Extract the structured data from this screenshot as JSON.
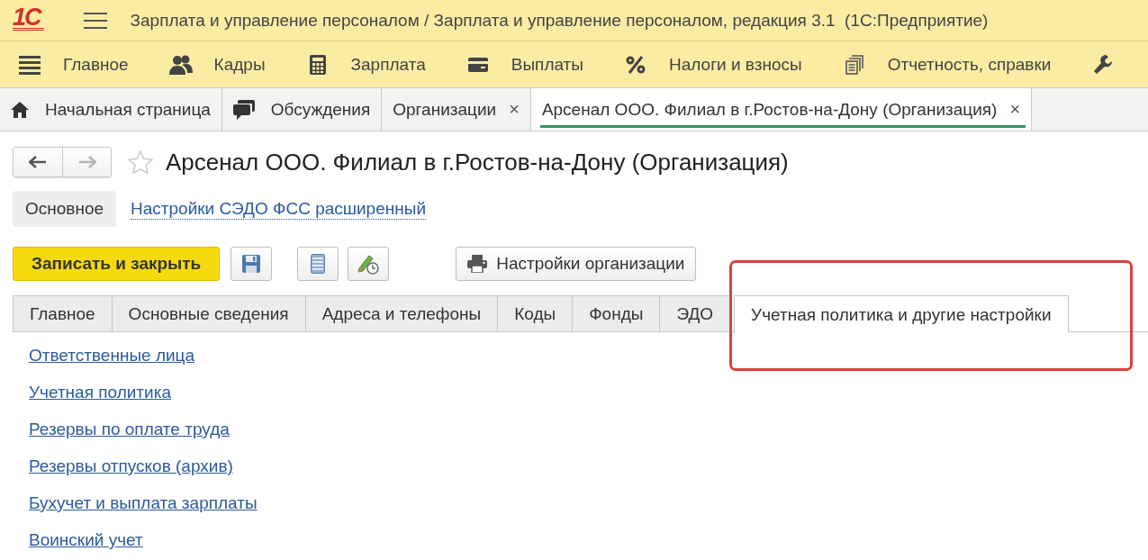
{
  "window": {
    "logo": "1С",
    "title": "Зарплата и управление персоналом / Зарплата и управление персоналом, редакция 3.1  (1С:Предприятие)"
  },
  "sections": [
    {
      "kind": "lines",
      "label": "Главное"
    },
    {
      "kind": "people",
      "label": "Кадры"
    },
    {
      "kind": "calculator",
      "label": "Зарплата"
    },
    {
      "kind": "card",
      "label": "Выплаты"
    },
    {
      "kind": "percent",
      "label": "Налоги и взносы"
    },
    {
      "kind": "documents",
      "label": "Отчетность, справки"
    },
    {
      "kind": "wrench"
    }
  ],
  "open_windows": [
    {
      "kind": "home",
      "label": "Начальная страница",
      "selected": false
    },
    {
      "kind": "chat",
      "label": "Обсуждения",
      "selected": false
    },
    {
      "kind": "closable",
      "label": "Организации",
      "close": "×",
      "selected": false
    },
    {
      "kind": "closable",
      "label": "Арсенал ООО. Филиал в г.Ростов-на-Дону (Организация)",
      "close": "×",
      "selected": true
    }
  ],
  "form": {
    "back": {
      "disabled": false
    },
    "forward": {
      "disabled": true
    },
    "favorite": false,
    "title": "Арсенал ООО. Филиал в г.Ростов-на-Дону (Организация)",
    "form_nav": [
      {
        "kind": "tab",
        "label": "Основное",
        "selected": true
      },
      {
        "kind": "link",
        "label": "Настройки СЭДО ФСС расширенный",
        "selected": false
      }
    ],
    "toolbar": [
      {
        "kind": "primary",
        "label": "Записать и закрыть"
      },
      {
        "kind": "save"
      },
      {
        "kind": "list"
      },
      {
        "kind": "pen-clock"
      },
      {
        "kind": "printer",
        "label": "Настройки организации"
      }
    ],
    "tabs": [
      {
        "label": "Главное",
        "selected": false
      },
      {
        "label": "Основные сведения",
        "selected": false
      },
      {
        "label": "Адреса и телефоны",
        "selected": false
      },
      {
        "label": "Коды",
        "selected": false
      },
      {
        "label": "Фонды",
        "selected": false
      },
      {
        "label": "ЭДО",
        "selected": false
      },
      {
        "label": "Учетная политика и другие настройки",
        "selected": true
      }
    ],
    "links": [
      "Ответственные лица",
      "Учетная политика",
      "Резервы по оплате труда",
      "Резервы отпусков (архив)",
      "Бухучет и выплата зарплаты",
      "Воинский учет"
    ]
  }
}
